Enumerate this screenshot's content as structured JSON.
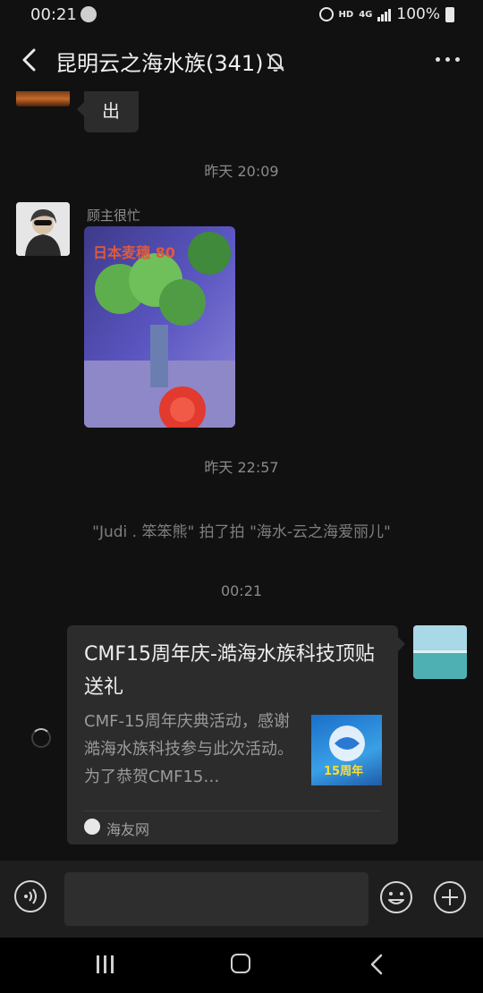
{
  "status_bar": {
    "time": "00:21",
    "hd": "HD",
    "network": "4G",
    "battery": "100%"
  },
  "header": {
    "title": "昆明云之海水族(341)",
    "icons": [
      "back-icon",
      "mute-icon",
      "more-icon"
    ]
  },
  "messages": {
    "partial_text": "出",
    "time1": "昨天 20:09",
    "sender_name": "顾主很忙",
    "photo_caption": "日本麦穗 80",
    "time2": "昨天 22:57",
    "pat_notice": "\"Judi . 笨笨熊\" 拍了拍 \"海水-云之海爱丽儿\"",
    "time3": "00:21"
  },
  "link_card": {
    "title": "CMF15周年庆-澔海水族科技顶贴送礼",
    "description": "CMF-15周年庆典活动，感谢澔海水族科技参与此次活动。为了恭贺CMF15…",
    "thumb_text": "15周年",
    "source": "海友网"
  },
  "input_bar": {
    "placeholder": "",
    "icons": [
      "voice-icon",
      "emoji-icon",
      "add-icon"
    ]
  },
  "nav_bar": {
    "icons": [
      "recents-icon",
      "home-icon",
      "back-nav-icon"
    ]
  },
  "colors": {
    "background": "#111111",
    "bubble": "#2c2c2c",
    "input_bar": "#1e1e1e"
  }
}
